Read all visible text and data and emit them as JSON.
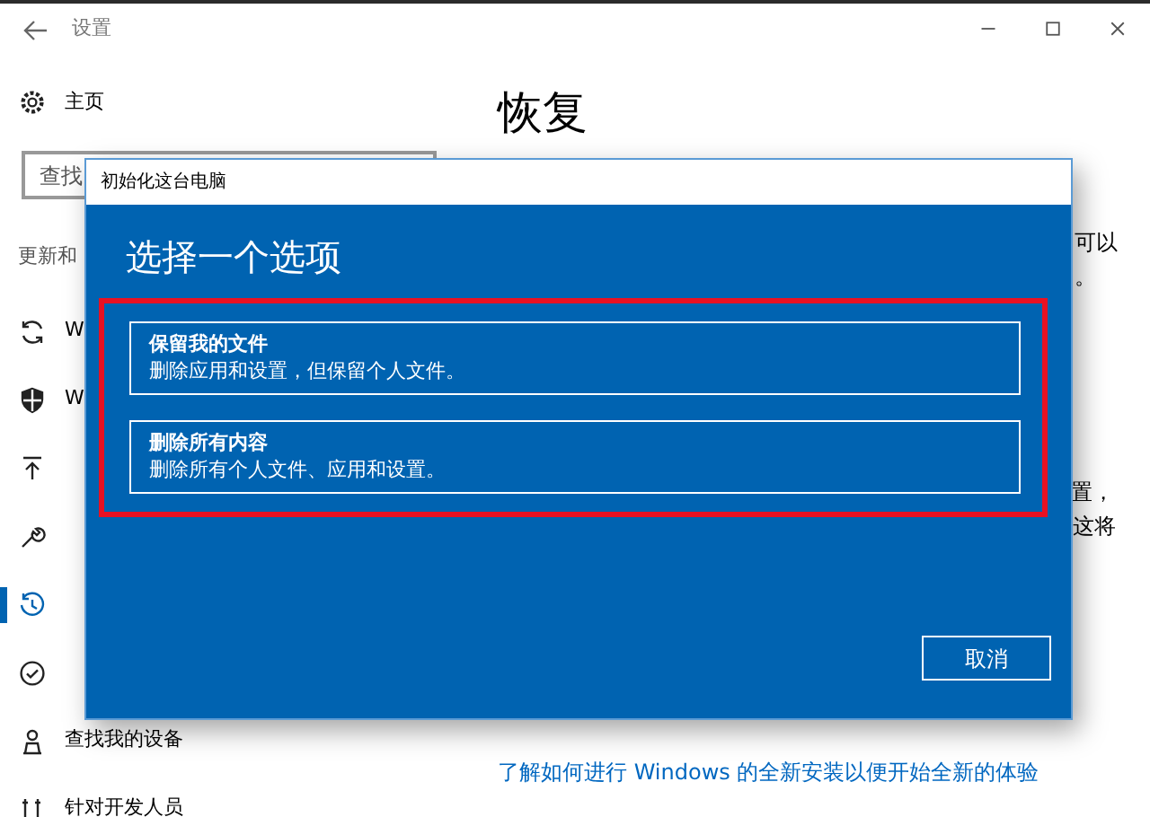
{
  "window": {
    "title": "设置"
  },
  "sidebar": {
    "home": "主页",
    "search": {
      "placeholder": "查找"
    },
    "section": "更新和",
    "items": [
      {
        "label": "W",
        "kind": "sync",
        "selected": false
      },
      {
        "label": "W",
        "kind": "shield",
        "selected": false
      },
      {
        "kind": "upload",
        "selected": false
      },
      {
        "kind": "wrench",
        "selected": false
      },
      {
        "kind": "history",
        "selected": true
      },
      {
        "kind": "check",
        "selected": false
      },
      {
        "label": "查找我的设备",
        "kind": "person",
        "selected": false
      },
      {
        "label": "针对开发人员",
        "kind": "tools",
        "selected": false
      }
    ]
  },
  "page": {
    "title": "恢复",
    "fragments": [
      "可以",
      "。",
      "置，",
      "这将"
    ],
    "link": "了解如何进行 Windows 的全新安装以便开始全新的体验"
  },
  "dialog": {
    "title": "初始化这台电脑",
    "heading": "选择一个选项",
    "highlighted": true,
    "options": [
      {
        "title": "保留我的文件",
        "description": "删除应用和设置，但保留个人文件。"
      },
      {
        "title": "删除所有内容",
        "description": "删除所有个人文件、应用和设置。"
      }
    ],
    "cancel": "取消"
  }
}
